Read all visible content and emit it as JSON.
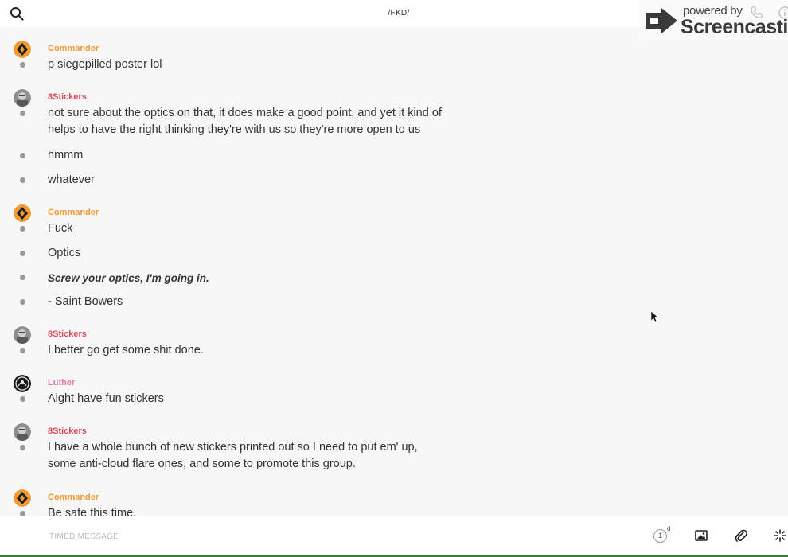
{
  "header": {
    "title": "/FKD/",
    "search_icon": "search-icon",
    "call_icon": "phone-icon",
    "info_icon": "info-icon"
  },
  "watermark": {
    "powered_by": "powered by",
    "brand": "Screencastify"
  },
  "colors": {
    "commander": "#f09a33",
    "8stickers": "#e0495a",
    "luther": "#e879a8",
    "composer_border": "#2e7d32"
  },
  "conversation": [
    {
      "author": "Commander",
      "messages": [
        "p siegepilled poster lol"
      ]
    },
    {
      "author": "8Stickers",
      "messages": [
        "not sure about the optics on that, it does make a good point, and yet it kind of helps to have the right thinking they're with us so they're more open to us",
        "hmmm",
        "whatever"
      ]
    },
    {
      "author": "Commander",
      "messages": [
        "Fuck",
        "Optics",
        "Screw your optics, I'm going in.",
        "- Saint Bowers"
      ]
    },
    {
      "author": "8Stickers",
      "messages": [
        "I better go get some shit done."
      ]
    },
    {
      "author": "Luther",
      "messages": [
        "Aight have fun stickers"
      ]
    },
    {
      "author": "8Stickers",
      "messages": [
        "I have a whole bunch of new stickers printed out so I need to put em' up, some anti-cloud flare ones, and some to promote this group."
      ]
    },
    {
      "author": "Commander",
      "messages": [
        "Be safe this time."
      ]
    }
  ],
  "composer": {
    "placeholder": "TIMED MESSAGE",
    "timer_value": "1",
    "timer_unit": "d",
    "image_icon": "image-icon",
    "attach_icon": "paperclip-icon",
    "effects_icon": "sparkle-icon"
  }
}
